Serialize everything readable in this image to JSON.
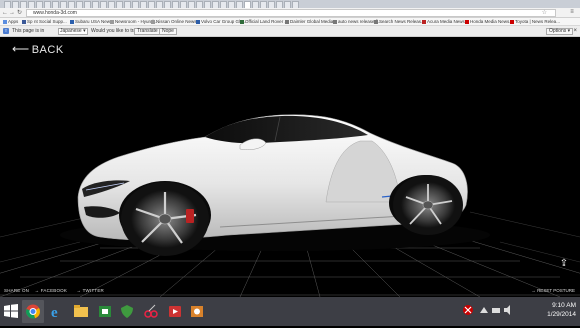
{
  "browser": {
    "url": "www.honda-3d.com",
    "bookmarks": [
      "Apps",
      "Sp",
      "nt Social Supp...",
      "Subaru USA News",
      "Newsroom - Hyund...",
      "Nissan Online News...",
      "Volvo Car Group Glo...",
      "Official Land Rover ...",
      "Daimler Global Media...",
      "auto news release fi...",
      "Search News Releas...",
      "Acura Media News...",
      "Honda Media News...",
      "Toyota | News Relea..."
    ]
  },
  "translate_bar": {
    "prefix": "This page is in",
    "language": "Japanese",
    "question": "Would you like to translate it?",
    "translate_label": "Translate",
    "nope_label": "Nope",
    "options_label": "Options"
  },
  "viewer": {
    "back_label": "BACK",
    "share_label": "SHARE ON",
    "facebook_label": "FACEBOOK",
    "twitter_label": "TWITTER",
    "right_label": "RESET POSTURE"
  },
  "taskbar": {
    "time": "9:10 AM",
    "date": "1/29/2014"
  }
}
